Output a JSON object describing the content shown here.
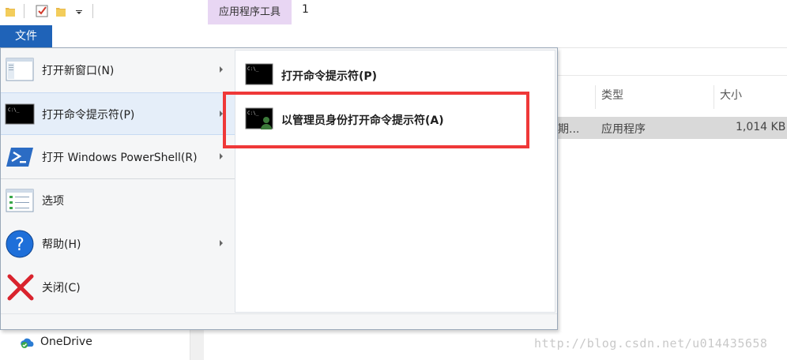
{
  "titlebar": {
    "contextual_tab": "应用程序工具",
    "title": "1"
  },
  "file_tab": "文件",
  "menu": {
    "items": [
      {
        "label": "打开新窗口(N)",
        "has_arrow": true,
        "icon": "new-window-icon"
      },
      {
        "label": "打开命令提示符(P)",
        "has_arrow": true,
        "icon": "command-prompt-icon"
      },
      {
        "label": "打开 Windows PowerShell(R)",
        "has_arrow": true,
        "icon": "powershell-icon"
      },
      {
        "label": "选项",
        "has_arrow": false,
        "icon": "options-icon"
      },
      {
        "label": "帮助(H)",
        "has_arrow": true,
        "icon": "help-icon"
      },
      {
        "label": "关闭(C)",
        "has_arrow": false,
        "icon": "close-icon"
      }
    ],
    "submenu": [
      {
        "label": "打开命令提示符(P)",
        "icon": "command-prompt-icon"
      },
      {
        "label": "以管理员身份打开命令提示符(A)",
        "icon": "admin-command-prompt-icon"
      }
    ]
  },
  "explorer": {
    "columns": [
      "类型",
      "大小"
    ],
    "row": {
      "date_fragment": "期...",
      "type": "应用程序",
      "size": "1,014 KB"
    },
    "nav_item": "OneDrive"
  },
  "watermark": "http://blog.csdn.net/u014435658",
  "colors": {
    "file_tab": "#1f63b8",
    "contextual_tab": "#e8d6f3",
    "highlight": "#ef3838",
    "selected_row": "#d9d9d9"
  }
}
